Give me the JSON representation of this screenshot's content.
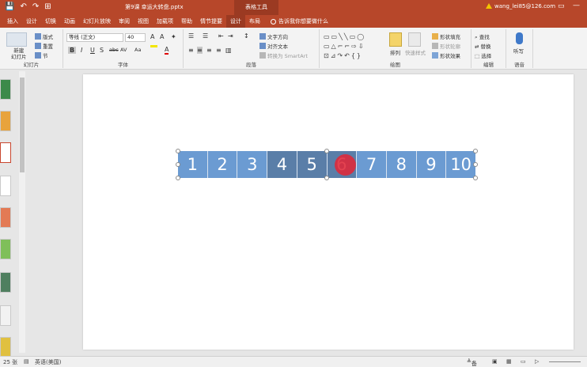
{
  "titlebar": {
    "doc_title": "第9课 幸运大转盘.pptx",
    "context_tool": "表格工具",
    "account": "wang_lei85@126.com",
    "qat": [
      "💾",
      "↶",
      "↷",
      "⊞"
    ]
  },
  "tabs": [
    "插入",
    "设计",
    "切换",
    "动画",
    "幻灯片放映",
    "审阅",
    "视图",
    "加载项",
    "帮助",
    "情节提要",
    "设计",
    "布局"
  ],
  "active_tab_index": 10,
  "search_tab": "告诉我你想要做什么",
  "ribbon": {
    "slides_group": {
      "label": "幻灯片",
      "new_slide": "新建\n幻灯片",
      "layout": "版式",
      "reset": "重置",
      "section": "节"
    },
    "font_group": {
      "label": "字体",
      "font_name": "等线 (正文)",
      "font_size": "40",
      "bold": "B",
      "italic": "I",
      "underline": "U",
      "strike": "S",
      "abc": "abc",
      "spacing": "AV",
      "case": "Aa",
      "font_color": "A"
    },
    "paragraph_group": {
      "label": "段落",
      "text_direction": "文字方向",
      "align_text": "对齐文本",
      "smartart": "转换为 SmartArt"
    },
    "drawing_group": {
      "label": "绘图",
      "arrange": "排列",
      "quick_styles": "快速样式",
      "shape_fill": "形状填充",
      "shape_outline": "形状轮廓",
      "shape_effects": "形状效果"
    },
    "editing_group": {
      "label": "编辑",
      "find": "查找",
      "replace": "替换",
      "select": "选择"
    },
    "voice_group": {
      "label": "语音",
      "dictate": "听写"
    }
  },
  "slide": {
    "table_cells": [
      "1",
      "2",
      "3",
      "4",
      "5",
      "6",
      "7",
      "8",
      "9",
      "10"
    ],
    "colors": {
      "light_cell": "#6b9bd2",
      "dark_cell": "#5a7ea8",
      "pointer": "#e02838"
    }
  },
  "statusbar": {
    "slide_count": "25 张",
    "language": "英语(美国)",
    "notes": "备注"
  }
}
